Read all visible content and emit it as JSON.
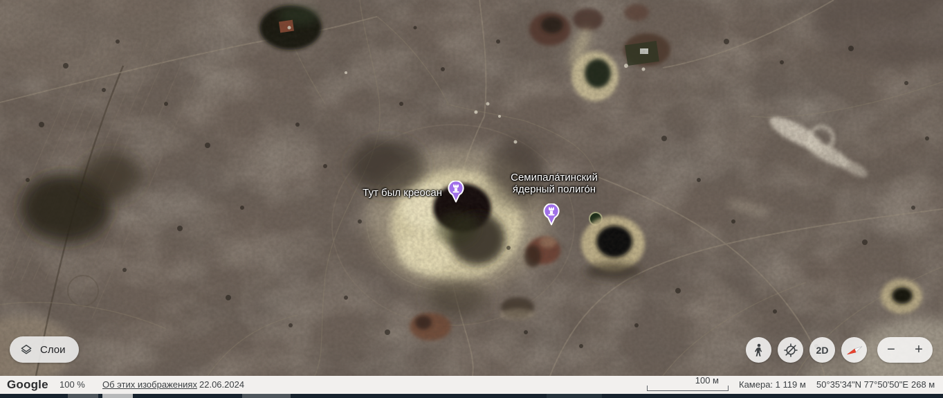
{
  "map": {
    "placemarks": [
      {
        "label": "Тут был креосан"
      },
      {
        "label_line1": "Семипала́тинский",
        "label_line2": "я́дерный полиго́н"
      }
    ],
    "pin_color": "#a070e8"
  },
  "layers_button": {
    "label": "Слои"
  },
  "controls": {
    "view_mode": "2D",
    "zoom_out": "−",
    "zoom_in": "+"
  },
  "statusbar": {
    "brand": "Google",
    "zoom_percent": "100 %",
    "imagery_link": "Об этих изображениях",
    "date": "22.06.2024",
    "scale_label": "100 м",
    "camera": "Камера: 1 119 м",
    "coordinates": "50°35'34\"N 77°50'50\"E",
    "elevation": "268 м"
  }
}
